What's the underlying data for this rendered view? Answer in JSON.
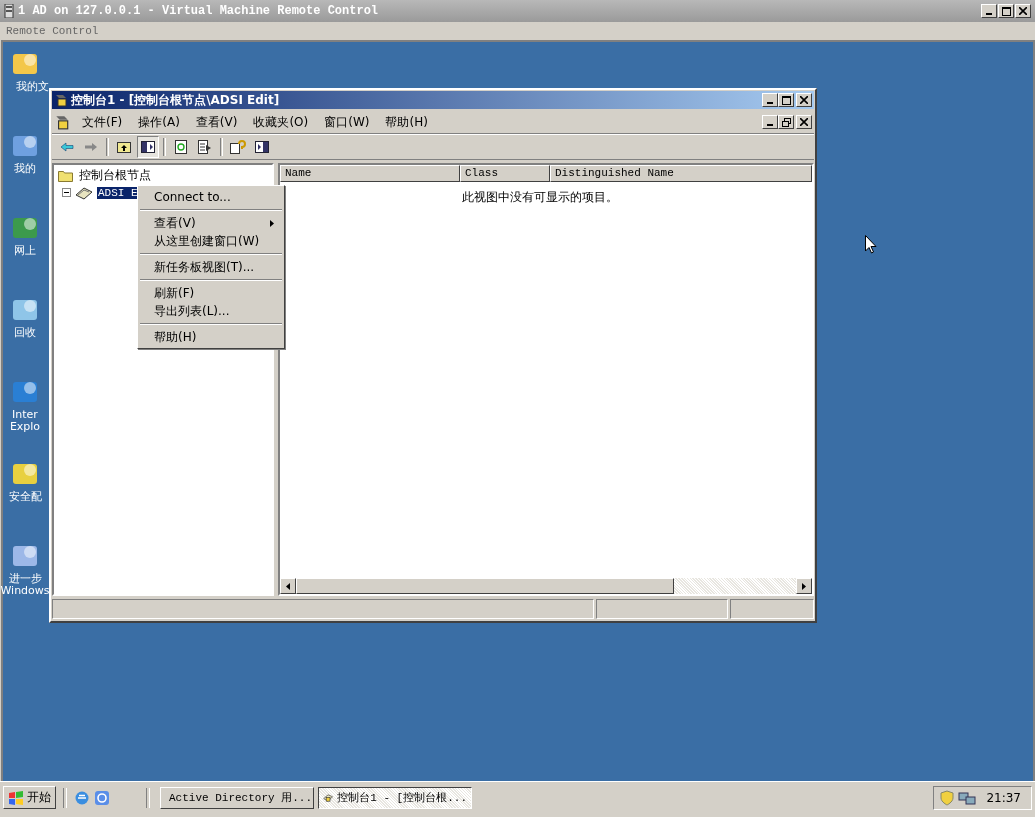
{
  "host_window": {
    "title": "1 AD on 127.0.0.1 - Virtual Machine Remote Control",
    "menu": [
      "Remote Control"
    ]
  },
  "desktop_icons": [
    {
      "lines": [
        "我的文"
      ]
    },
    {
      "lines": [
        "我的"
      ]
    },
    {
      "lines": [
        "网上"
      ]
    },
    {
      "lines": [
        "回收"
      ]
    },
    {
      "lines": [
        "Inter",
        "Explo"
      ]
    },
    {
      "lines": [
        "安全配"
      ]
    },
    {
      "lines": [
        "进一步",
        "Windows"
      ]
    }
  ],
  "console_window": {
    "title": "控制台1 - [控制台根节点\\ADSI Edit]",
    "menus": [
      "文件(F)",
      "操作(A)",
      "查看(V)",
      "收藏夹(O)",
      "窗口(W)",
      "帮助(H)"
    ],
    "toolbar": {
      "tree_pressed": true
    },
    "tree": [
      {
        "label": "控制台根节点",
        "selected": false,
        "children": [
          {
            "label": "ADSI E",
            "selected": true,
            "expanded": true
          }
        ]
      }
    ],
    "columns": [
      "Name",
      "Class",
      "Distinguished Name"
    ],
    "empty_message": "此视图中没有可显示的项目。"
  },
  "context_menu": [
    {
      "kind": "item",
      "label": "Connect to...",
      "submenu": false
    },
    {
      "kind": "separator"
    },
    {
      "kind": "item",
      "label": "查看(V)",
      "submenu": true
    },
    {
      "kind": "item",
      "label": "从这里创建窗口(W)",
      "submenu": false
    },
    {
      "kind": "separator"
    },
    {
      "kind": "item",
      "label": "新任务板视图(T)...",
      "submenu": false
    },
    {
      "kind": "separator"
    },
    {
      "kind": "item",
      "label": "刷新(F)",
      "submenu": false
    },
    {
      "kind": "item",
      "label": "导出列表(L)...",
      "submenu": false
    },
    {
      "kind": "separator"
    },
    {
      "kind": "item",
      "label": "帮助(H)",
      "submenu": false
    }
  ],
  "taskbar": {
    "start": "开始",
    "tasks": [
      {
        "label": "Active Directory 用...",
        "selected": false
      },
      {
        "label": "控制台1 - [控制台根...",
        "selected": true
      }
    ],
    "clock": "21:37"
  }
}
